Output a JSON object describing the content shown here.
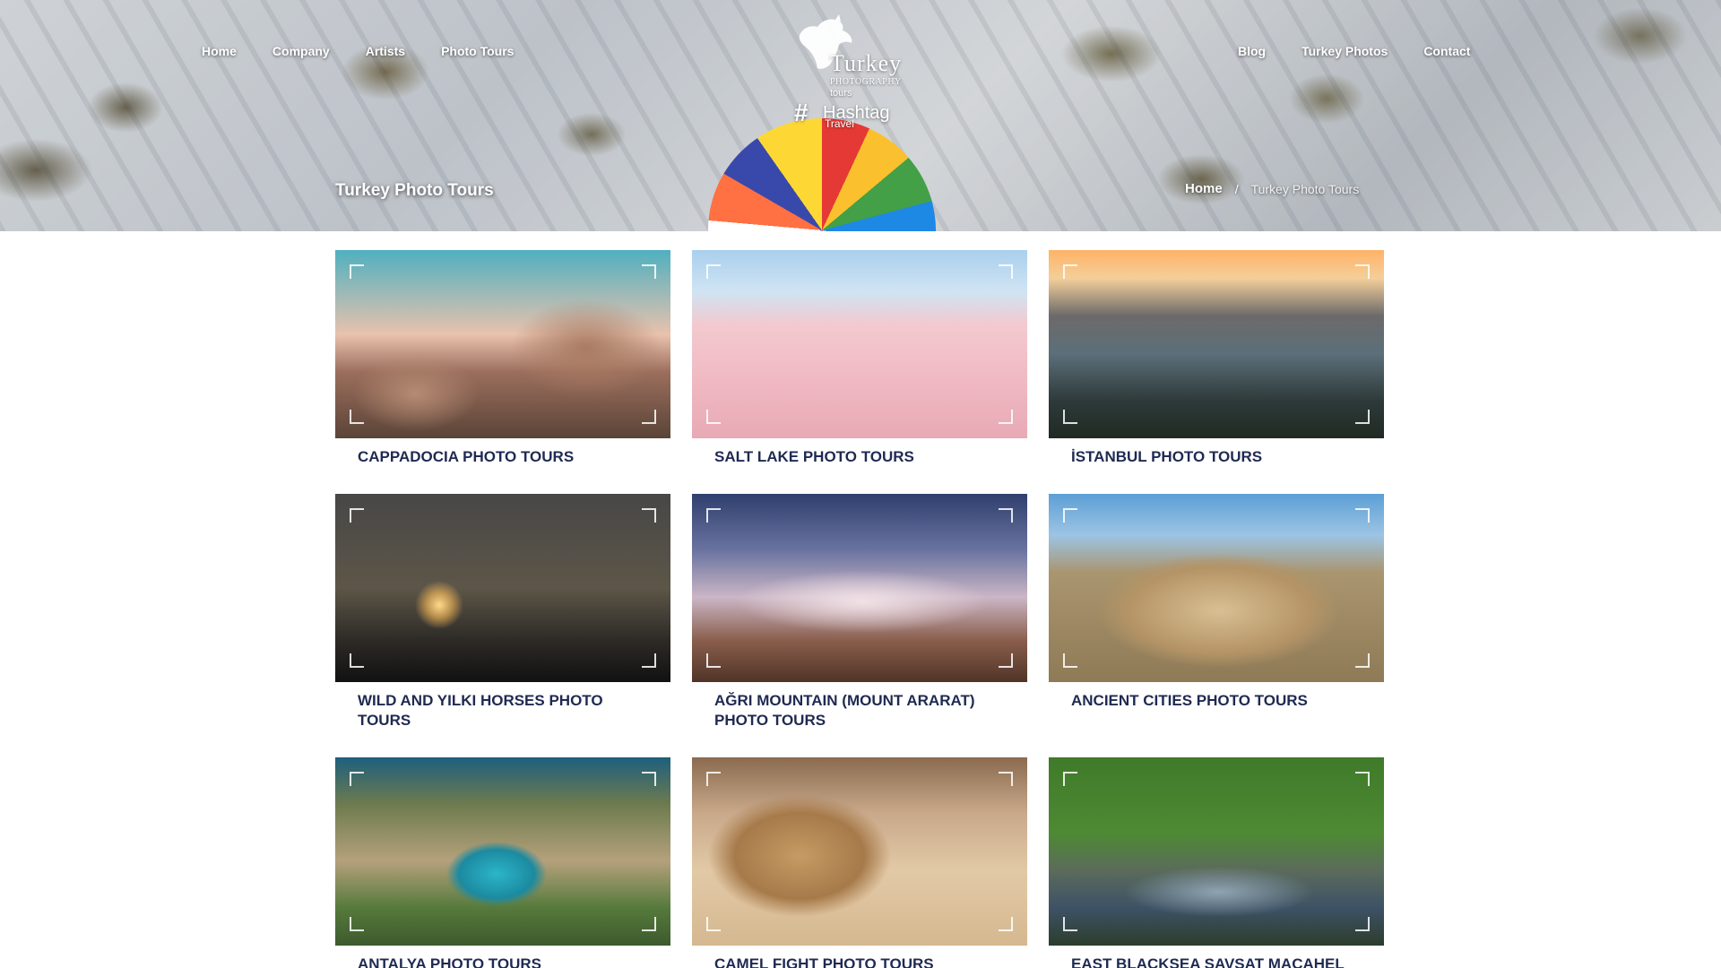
{
  "nav": {
    "left": [
      "Home",
      "Company",
      "Artists",
      "Photo Tours"
    ],
    "right": [
      "Blog",
      "Turkey Photos",
      "Contact"
    ]
  },
  "logo": {
    "brand": "Turkey",
    "subtitle": "PHOTOGRAPHY",
    "subtitle2": "tours",
    "hash_symbol": "#",
    "hash_text": "Hashtag",
    "travel": "Travel"
  },
  "hero": {
    "page_title": "Turkey Photo Tours",
    "breadcrumb": {
      "home": "Home",
      "separator": "/",
      "current": "Turkey Photo Tours"
    }
  },
  "tours": [
    {
      "title": "CAPPADOCIA PHOTO TOURS",
      "image": "cappadocia"
    },
    {
      "title": "SALT LAKE PHOTO TOURS",
      "image": "saltlake"
    },
    {
      "title": "İSTANBUL PHOTO TOURS",
      "image": "istanbul"
    },
    {
      "title": "WILD AND YILKI HORSES PHOTO TOURS",
      "image": "horses"
    },
    {
      "title": "AĞRI MOUNTAIN (MOUNT ARARAT) PHOTO TOURS",
      "image": "agri"
    },
    {
      "title": "ANCIENT CITIES PHOTO TOURS",
      "image": "ancient"
    },
    {
      "title": "ANTALYA PHOTO TOURS",
      "image": "antalya"
    },
    {
      "title": "CAMEL FIGHT PHOTO TOURS",
      "image": "camel"
    },
    {
      "title": "EAST BLACKSEA SAVSAT MACAHEL",
      "image": "savsat"
    }
  ]
}
